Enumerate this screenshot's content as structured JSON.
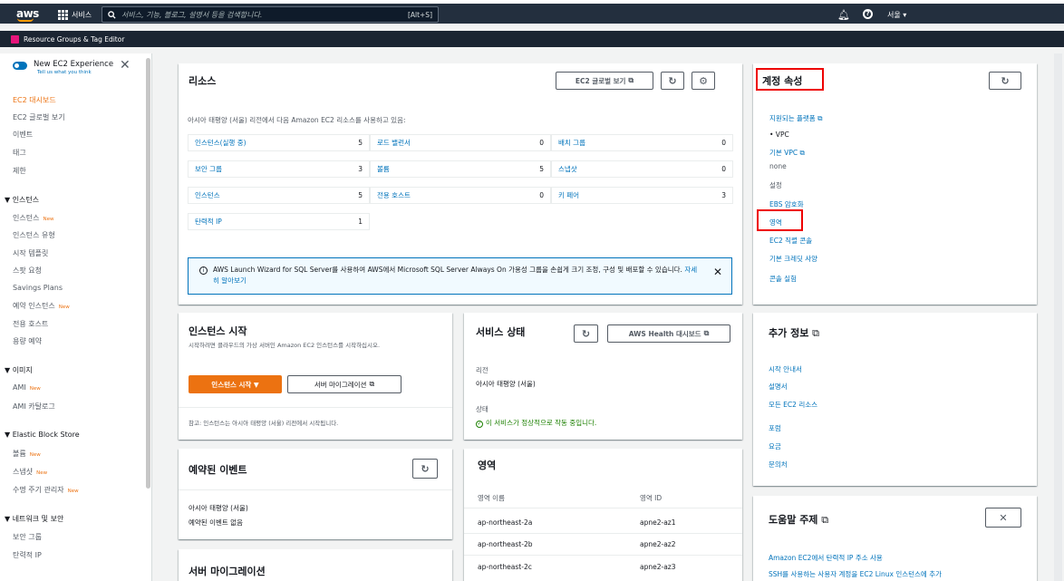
{
  "topbar": {
    "logo": "aws",
    "services_label": "서비스",
    "search_placeholder": "서비스, 기능, 블로그, 설명서 등을 검색합니다.",
    "search_shortcut": "[Alt+S]",
    "region_label": "서울 ▾"
  },
  "rg_bar": {
    "label": "Resource Groups & Tag Editor"
  },
  "sidebar": {
    "new_experience": "New EC2 Experience",
    "tell_us": "Tell us what you think",
    "items": [
      {
        "label": "EC2 대시보드",
        "active": true
      },
      {
        "label": "EC2 글로벌 보기"
      },
      {
        "label": "이벤트"
      },
      {
        "label": "태그"
      },
      {
        "label": "제한"
      }
    ],
    "section_instances": "▼ 인스턴스",
    "instance_items": [
      {
        "label": "인스턴스",
        "badge": "New"
      },
      {
        "label": "인스턴스 유형"
      },
      {
        "label": "시작 템플릿"
      },
      {
        "label": "스팟 요청"
      },
      {
        "label": "Savings Plans"
      },
      {
        "label": "예약 인스턴스",
        "badge": "New"
      },
      {
        "label": "전용 호스트"
      },
      {
        "label": "용량 예약"
      }
    ],
    "section_images": "▼ 이미지",
    "image_items": [
      {
        "label": "AMI",
        "badge": "New"
      },
      {
        "label": "AMI 카탈로그"
      }
    ],
    "section_ebs": "▼ Elastic Block Store",
    "ebs_items": [
      {
        "label": "볼륨",
        "badge": "New"
      },
      {
        "label": "스냅샷",
        "badge": "New"
      },
      {
        "label": "수명 주기 관리자",
        "badge": "New"
      }
    ],
    "section_network": "▼ 네트워크 및 보안",
    "network_items": [
      {
        "label": "보안 그룹"
      },
      {
        "label": "탄력적 IP"
      }
    ]
  },
  "resources": {
    "title": "리소스",
    "global_view_btn": "EC2 글로벌 보기",
    "description": "아시아 태평양 (서울) 리전에서 다음 Amazon EC2 리소스를 사용하고 있음:",
    "cells": [
      {
        "label": "인스턴스(실행 중)",
        "value": "5"
      },
      {
        "label": "로드 밸런서",
        "value": "0"
      },
      {
        "label": "배치 그룹",
        "value": "0"
      },
      {
        "label": "보안 그룹",
        "value": "3"
      },
      {
        "label": "볼륨",
        "value": "5"
      },
      {
        "label": "스냅샷",
        "value": "0"
      },
      {
        "label": "인스턴스",
        "value": "5"
      },
      {
        "label": "전용 호스트",
        "value": "0"
      },
      {
        "label": "키 페어",
        "value": "3"
      },
      {
        "label": "탄력적 IP",
        "value": "1"
      }
    ],
    "info_text": "AWS Launch Wizard for SQL Server를 사용하여 AWS에서 Microsoft SQL Server Always On 가용성 그룹을 손쉽게 크기 조정, 구성 및 배포할 수 있습니다.",
    "info_link": "자세히 알아보기"
  },
  "account": {
    "title": "계정 속성",
    "supported_platforms": "지원되는 플랫폼",
    "vpc": "• VPC",
    "default_vpc": "기본 VPC",
    "none": "none",
    "settings": "설정",
    "ebs_encryption": "EBS 암호화",
    "zones": "영역",
    "ec2_serial_console": "EC2 직렬 콘솔",
    "default_credit": "기본 크레딧 사양",
    "console_experiments": "콘솔 실험"
  },
  "launch": {
    "title": "인스턴스 시작",
    "desc": "시작하려면 클라우드의 가상 서버인 Amazon EC2 인스턴스를 시작하십시오.",
    "launch_btn": "인스턴스 시작 ▼",
    "migrate_btn": "서버 마이그레이션",
    "note": "참고: 인스턴스는 아시아 태평양 (서울) 리전에서 시작됩니다."
  },
  "service_health": {
    "title": "서비스 상태",
    "dashboard_btn": "AWS Health 대시보드",
    "region_label": "리전",
    "region_value": "아시아 태평양 (서울)",
    "status_label": "상태",
    "status_value": "이 서비스가 정상적으로 작동 중입니다."
  },
  "scheduled": {
    "title": "예약된 이벤트",
    "region": "아시아 태평양 (서울)",
    "empty": "예약된 이벤트 없음"
  },
  "zones": {
    "title": "영역",
    "col_name": "영역 이름",
    "col_id": "영역 ID",
    "rows": [
      {
        "name": "ap-northeast-2a",
        "id": "apne2-az1"
      },
      {
        "name": "ap-northeast-2b",
        "id": "apne2-az2"
      },
      {
        "name": "ap-northeast-2c",
        "id": "apne2-az3"
      }
    ]
  },
  "extra_info": {
    "title": "추가 정보",
    "links": [
      "시작 안내서",
      "설명서",
      "모든 EC2 리소스",
      "포럼",
      "요금",
      "문의처"
    ]
  },
  "help_topics": {
    "title": "도움말 주제",
    "links": [
      "Amazon EC2에서 탄력적 IP 주소 사용",
      "SSH를 사용하는 사용자 계정을 EC2 Linux 인스턴스에 추가"
    ]
  },
  "migration": {
    "title": "서버 마이그레이션"
  },
  "icons": {
    "refresh": "refresh-icon",
    "settings": "gear-icon",
    "external": "external-link-icon",
    "close": "close-icon"
  },
  "colors": {
    "orange": "#ec7211",
    "link": "#0073bb",
    "nav": "#232f3e",
    "highlight": "#e00000"
  }
}
